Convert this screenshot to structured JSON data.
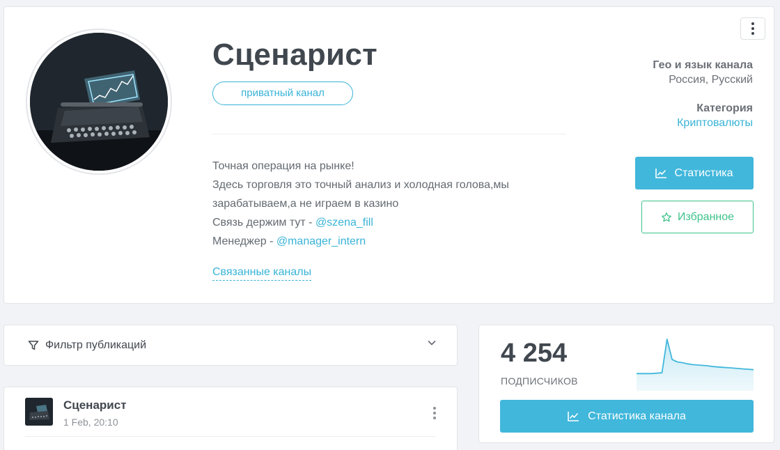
{
  "channel": {
    "title": "Сценарист",
    "badge": "приватный канал",
    "description": [
      {
        "text": "Точная операция на рынке!",
        "link": ""
      },
      {
        "text": "Здесь торговля это точный анализ и холодная голова,мы",
        "link": ""
      },
      {
        "text": "зарабатываем,а не играем в казино",
        "link": ""
      },
      {
        "text": "Связь держим тут - ",
        "link": "@szena_fill"
      },
      {
        "text": "Менеджер - ",
        "link": "@manager_intern"
      }
    ],
    "related_link": "Связанные каналы",
    "geo_label": "Гео и язык канала",
    "geo_value": "Россия, Русский",
    "category_label": "Категория",
    "category_value": "Криптовалюты",
    "stats_button": "Статистика",
    "favorite_button": "Избранное"
  },
  "filter": {
    "label": "Фильтр публикаций"
  },
  "post": {
    "author": "Сценарист",
    "date": "1 Feb, 20:10"
  },
  "subscribers": {
    "count": "4 254",
    "label": "ПОДПИСЧИКОВ",
    "button": "Статистика канала",
    "trend": [
      0.12,
      0.12,
      0.12,
      0.12,
      0.13,
      0.14,
      1.0,
      0.48,
      0.42,
      0.4,
      0.37,
      0.35,
      0.34,
      0.33,
      0.32,
      0.3,
      0.29,
      0.28,
      0.27,
      0.26,
      0.25,
      0.24,
      0.23,
      0.22
    ]
  },
  "colors": {
    "accent": "#41b7db",
    "favorite": "#3ec28b",
    "text": "#40474e"
  },
  "icons": {
    "menu": "kebab-vertical-icon",
    "stats": "line-chart-icon",
    "favorite": "star-icon",
    "filter": "funnel-icon",
    "dropdown": "chevron-down-icon"
  }
}
